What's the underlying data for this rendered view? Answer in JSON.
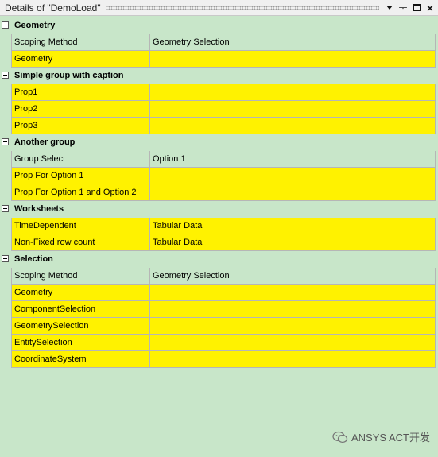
{
  "panel": {
    "title": "Details of \"DemoLoad\""
  },
  "groups": [
    {
      "label": "Geometry",
      "rows": [
        {
          "name": "Scoping Method",
          "value": "Geometry Selection",
          "color": "green"
        },
        {
          "name": "Geometry",
          "value": "",
          "color": "yellow"
        }
      ]
    },
    {
      "label": "Simple group with caption",
      "rows": [
        {
          "name": "Prop1",
          "value": "",
          "color": "yellow"
        },
        {
          "name": "Prop2",
          "value": "",
          "color": "yellow"
        },
        {
          "name": "Prop3",
          "value": "",
          "color": "yellow"
        }
      ]
    },
    {
      "label": "Another group",
      "rows": [
        {
          "name": "Group Select",
          "value": "Option 1",
          "color": "green"
        },
        {
          "name": "Prop For Option 1",
          "value": "",
          "color": "yellow"
        },
        {
          "name": "Prop For Option 1 and Option 2",
          "value": "",
          "color": "yellow"
        }
      ]
    },
    {
      "label": "Worksheets",
      "rows": [
        {
          "name": "TimeDependent",
          "value": "Tabular Data",
          "color": "yellow"
        },
        {
          "name": "Non-Fixed row count",
          "value": "Tabular Data",
          "color": "yellow"
        }
      ]
    },
    {
      "label": "Selection",
      "rows": [
        {
          "name": "Scoping Method",
          "value": "Geometry Selection",
          "color": "green"
        },
        {
          "name": "Geometry",
          "value": "",
          "color": "yellow"
        },
        {
          "name": "ComponentSelection",
          "value": "",
          "color": "yellow"
        },
        {
          "name": "GeometrySelection",
          "value": "",
          "color": "yellow"
        },
        {
          "name": "EntitySelection",
          "value": "",
          "color": "yellow"
        },
        {
          "name": "CoordinateSystem",
          "value": "",
          "color": "yellow"
        }
      ]
    }
  ],
  "watermark": {
    "text": "ANSYS ACT开发",
    "icon": "wechat-icon"
  },
  "colors": {
    "background": "#c8e6c9",
    "highlight": "#fff200"
  }
}
